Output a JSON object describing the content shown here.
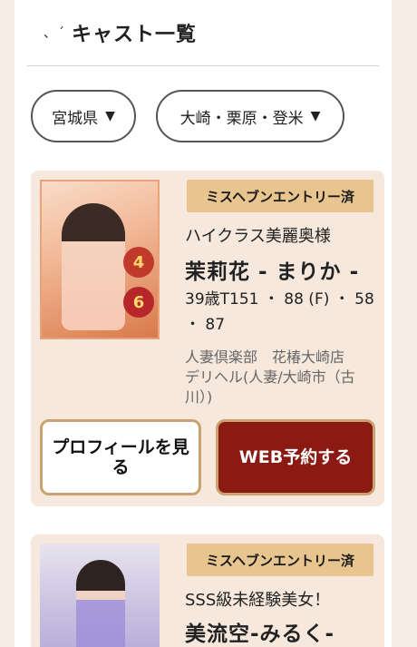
{
  "header": {
    "mark": "、´",
    "title": "キャスト一覧"
  },
  "filters": {
    "prefecture": "宮城県",
    "area": "大崎・栗原・登米"
  },
  "casts": [
    {
      "entry_badge": "ミスヘブンエントリー済",
      "catchphrase": "ハイクラス美麗奥様",
      "name": "茉莉花 - まりか -",
      "specs": "39歳T151 ・ 88 (F) ・ 58 ・ 87",
      "shop_name": "人妻倶楽部　花椿大崎店",
      "shop_type": "デリヘル(人妻/大崎市（古川）)",
      "rank_badge_1": "4",
      "rank_badge_2": "6",
      "profile_button": "プロフィールを見る",
      "web_button": "WEB予約する"
    },
    {
      "entry_badge": "ミスヘブンエントリー済",
      "catchphrase": "SSS級未経験美女！",
      "name": "美流空-みるく-"
    }
  ]
}
